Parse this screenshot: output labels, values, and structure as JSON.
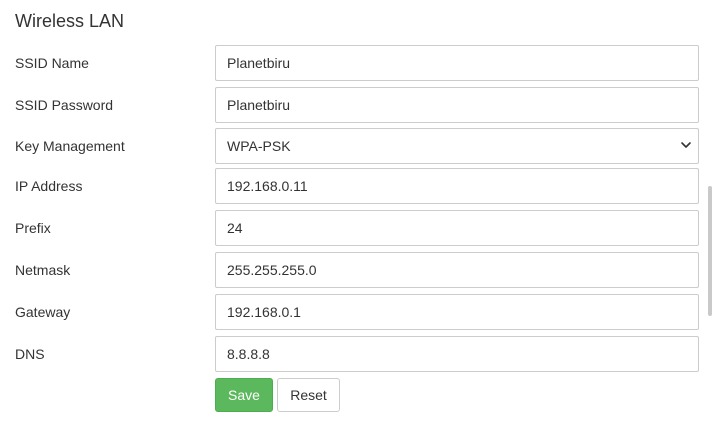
{
  "section": {
    "title": "Wireless LAN"
  },
  "form": {
    "ssid_name": {
      "label": "SSID Name",
      "value": "Planetbiru"
    },
    "ssid_password": {
      "label": "SSID Password",
      "value": "Planetbiru"
    },
    "key_management": {
      "label": "Key Management",
      "value": "WPA-PSK"
    },
    "ip_address": {
      "label": "IP Address",
      "value": "192.168.0.11"
    },
    "prefix": {
      "label": "Prefix",
      "value": "24"
    },
    "netmask": {
      "label": "Netmask",
      "value": "255.255.255.0"
    },
    "gateway": {
      "label": "Gateway",
      "value": "192.168.0.1"
    },
    "dns": {
      "label": "DNS",
      "value": "8.8.8.8"
    }
  },
  "buttons": {
    "save_label": "Save",
    "reset_label": "Reset"
  },
  "icons": {
    "select_chevron": "chevron-down-icon"
  },
  "colors": {
    "save_button": "#5cb85c",
    "text": "#333333",
    "border": "#cccccc"
  }
}
